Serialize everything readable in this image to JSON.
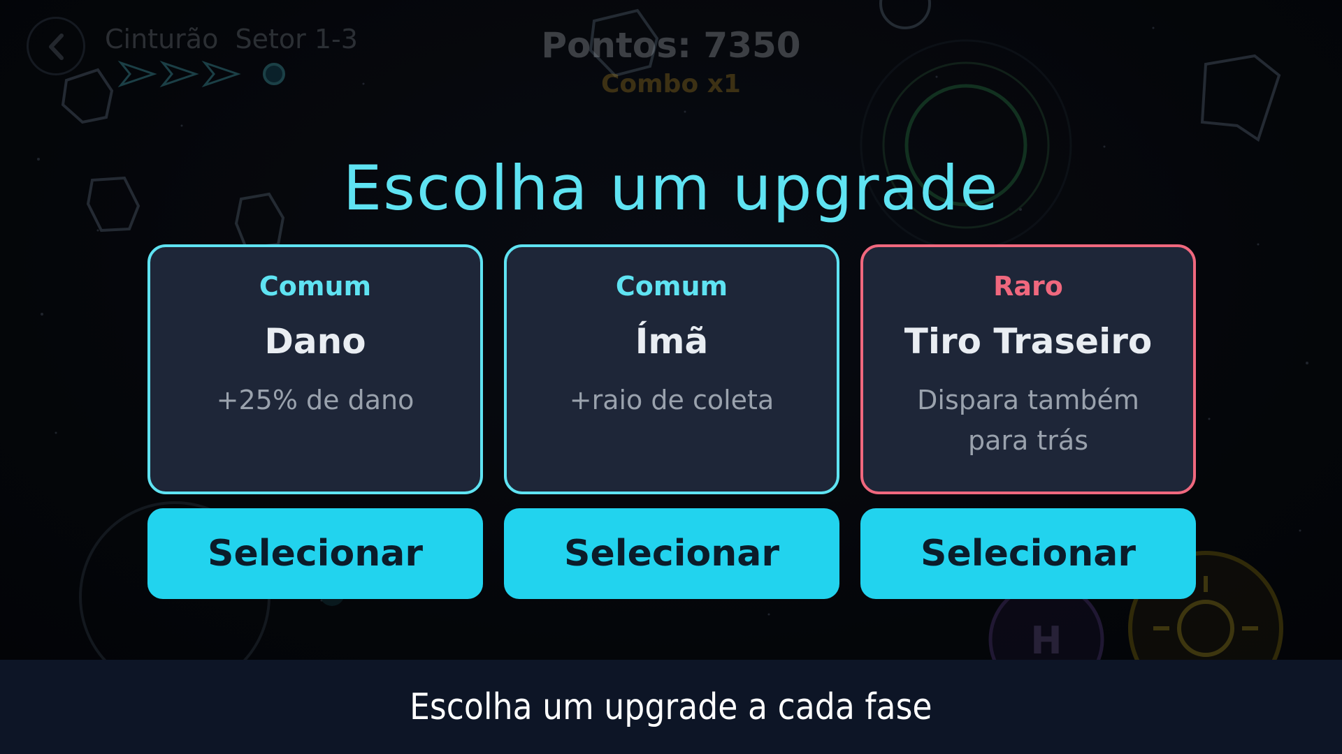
{
  "hud": {
    "zone_label": "Cinturão  Setor 1-3",
    "score_text": "Pontos: 7350",
    "combo_text": "Combo x1"
  },
  "overlay": {
    "title": "Escolha um upgrade",
    "cards": [
      {
        "rarity": "Comum",
        "name": "Dano",
        "description": "+25% de dano",
        "button": "Selecionar"
      },
      {
        "rarity": "Comum",
        "name": "Ímã",
        "description": "+raio de coleta",
        "button": "Selecionar"
      },
      {
        "rarity": "Raro",
        "name": "Tiro Traseiro",
        "description": "Dispara também para trás",
        "button": "Selecionar"
      }
    ]
  },
  "caption": "Escolha um upgrade a cada fase",
  "controls": {
    "hyperspace_letter": "H"
  },
  "colors": {
    "accent_cyan": "#5fe3f2",
    "button_cyan": "#22d3ee",
    "rare_pink": "#f0687e",
    "card_bg": "#1e2638",
    "combo_gold": "#d9a72b"
  },
  "icons": [
    "back-chevron-icon",
    "ship-arrow-icon",
    "crosshair-fire-icon",
    "hyperspace-icon",
    "asteroid-icon",
    "joystick-icon"
  ]
}
